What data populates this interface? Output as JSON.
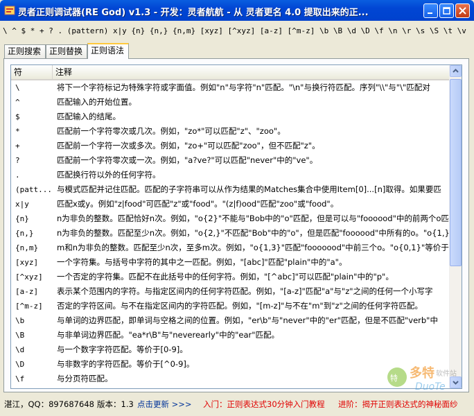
{
  "window": {
    "title": "灵者正则调试器(RE God) v1.3 - 开发：灵者航航 - 从 灵者更名 4.0 提取出来的正..."
  },
  "regex_bar": "\\ ^ $ * + ? . (pattern) x|y {n} {n,} {n,m} [xyz] [^xyz] [a-z] [^m-z] \\b \\B \\d \\D \\f \\n \\r \\s \\S \\t \\v \\w \\W \\num \\n",
  "tabs": [
    {
      "label": "正则搜索"
    },
    {
      "label": "正则替换"
    },
    {
      "label": "正则语法"
    }
  ],
  "table": {
    "columns": [
      "符",
      "注释"
    ],
    "rows": [
      {
        "sym": "\\",
        "desc": "将下一个字符标记为特殊字符或字面值。例如\"n\"与字符\"n\"匹配。\"\\n\"与换行符匹配。序列\"\\\\\"与\"\\\"匹配对"
      },
      {
        "sym": "^",
        "desc": "匹配输入的开始位置。"
      },
      {
        "sym": "$",
        "desc": "匹配输入的结尾。"
      },
      {
        "sym": "*",
        "desc": "匹配前一个字符零次或几次。例如，\"zo*\"可以匹配\"z\"、\"zoo\"。"
      },
      {
        "sym": "+",
        "desc": "匹配前一个字符一次或多次。例如，\"zo+\"可以匹配\"zoo\"，但不匹配\"z\"。"
      },
      {
        "sym": "?",
        "desc": "匹配前一个字符零次或一次。例如，\"a?ve?\"可以匹配\"never\"中的\"ve\"。"
      },
      {
        "sym": ".",
        "desc": "匹配换行符以外的任何字符。"
      },
      {
        "sym": "(patt...",
        "desc": "与模式匹配并记住匹配。匹配的子字符串可以从作为结果的Matches集合中使用Item[0]...[n]取得。如果要匹"
      },
      {
        "sym": "x|y",
        "desc": "匹配x或y。例如\"z|food\"可匹配\"z\"或\"food\"。\"(z|f)ood\"匹配\"zoo\"或\"food\"。"
      },
      {
        "sym": "{n}",
        "desc": "n为非负的整数。匹配恰好n次。例如，\"o{2}\"不能与\"Bob中的\"o\"匹配，但是可以与\"foooood\"中的前两个o匹配"
      },
      {
        "sym": "{n,}",
        "desc": "n为非负的整数。匹配至少n次。例如，\"o{2,}\"不匹配\"Bob\"中的\"o\"，但是匹配\"foooood\"中所有的o。\"o{1,}"
      },
      {
        "sym": "{n,m}",
        "desc": "m和n为非负的整数。匹配至少n次，至多m次。例如，\"o{1,3}\"匹配\"fooooood\"中前三个o。\"o{0,1}\"等价于\"o?\""
      },
      {
        "sym": "[xyz]",
        "desc": "一个字符集。与括号中字符的其中之一匹配。例如，\"[abc]\"匹配\"plain\"中的\"a\"。"
      },
      {
        "sym": "[^xyz]",
        "desc": "一个否定的字符集。匹配不在此括号中的任何字符。例如，\"[^abc]\"可以匹配\"plain\"中的\"p\"。"
      },
      {
        "sym": "[a-z]",
        "desc": "表示某个范围内的字符。与指定区间内的任何字符匹配。例如，\"[a-z]\"匹配\"a\"与\"z\"之间的任何一个小写字"
      },
      {
        "sym": "[^m-z]",
        "desc": "否定的字符区间。与不在指定区间内的字符匹配。例如，\"[m-z]\"与不在\"m\"到\"z\"之间的任何字符匹配。"
      },
      {
        "sym": "\\b",
        "desc": "与单词的边界匹配，即单词与空格之间的位置。例如，\"er\\b\"与\"never\"中的\"er\"匹配，但是不匹配\"verb\"中"
      },
      {
        "sym": "\\B",
        "desc": "与非单词边界匹配。\"ea*r\\B\"与\"neverearly\"中的\"ear\"匹配。"
      },
      {
        "sym": "\\d",
        "desc": "与一个数字字符匹配。等价于[0-9]。"
      },
      {
        "sym": "\\D",
        "desc": "与非数字的字符匹配。等价于[^0-9]。"
      },
      {
        "sym": "\\f",
        "desc": "与分页符匹配。"
      }
    ]
  },
  "watermark": {
    "line1": "多特",
    "line2": "软件站",
    "line3": "DuoTe"
  },
  "status": {
    "contact": "湛江，QQ：897687648",
    "version": "版本：1.3",
    "update_link": "点击更新 >>>",
    "link_intro": "入门：正则表达式30分钟入门教程",
    "link_advanced": "进阶：揭开正则表达式的神秘面纱"
  },
  "colors": {
    "link_red": "#e00000",
    "update_blue": "#003399",
    "title_blue": "#0046d5"
  }
}
